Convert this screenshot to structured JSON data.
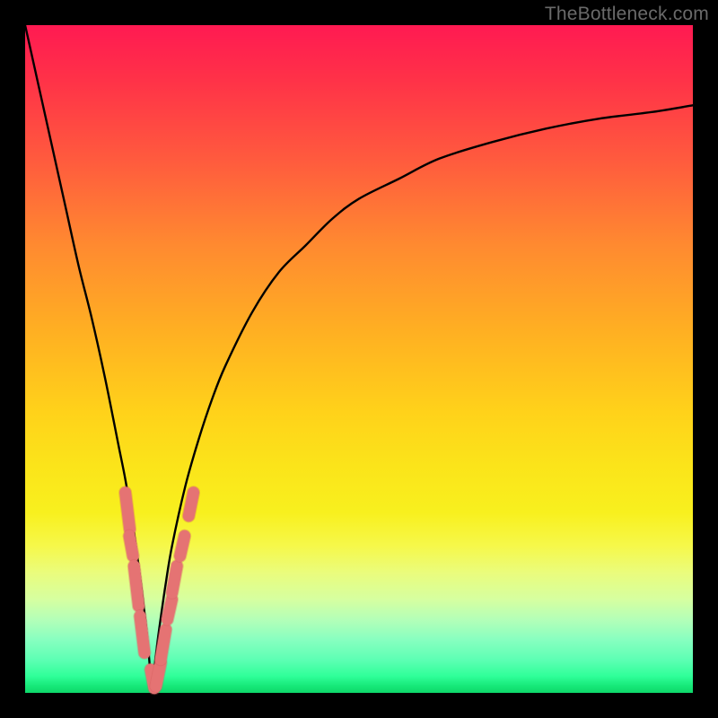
{
  "watermark": "TheBottleneck.com",
  "colors": {
    "frame": "#000000",
    "curve": "#000000",
    "markers_fill": "#e57373",
    "markers_stroke": "#d45f5f"
  },
  "chart_data": {
    "type": "line",
    "title": "",
    "xlabel": "",
    "ylabel": "",
    "xlim": [
      0,
      100
    ],
    "ylim": [
      0,
      100
    ],
    "note": "Unlabeled bottleneck V-curve; x axis ~ component ratio, y axis ~ bottleneck %. Minimum near x≈19, y≈0. Values estimated from pixels (plot has no tick labels).",
    "series": [
      {
        "name": "bottleneck-curve",
        "x": [
          0,
          2,
          4,
          6,
          8,
          10,
          12,
          14,
          15,
          16,
          17,
          18,
          18.5,
          19,
          19.5,
          20,
          21,
          22,
          24,
          26,
          28,
          30,
          34,
          38,
          42,
          46,
          50,
          56,
          62,
          70,
          78,
          86,
          94,
          100
        ],
        "y": [
          100,
          91,
          82,
          73,
          64,
          56,
          47,
          37,
          32,
          26,
          19,
          11,
          6,
          1,
          5,
          9,
          16,
          22,
          31,
          38,
          44,
          49,
          57,
          63,
          67,
          71,
          74,
          77,
          80,
          82.5,
          84.5,
          86,
          87,
          88
        ]
      }
    ],
    "markers": {
      "description": "Short pink pill-shaped markers clustered on both sides of the curve near its bottom",
      "segments": [
        {
          "side": "left",
          "x": 15.0,
          "y0": 30.0,
          "y1": 24.5
        },
        {
          "side": "left",
          "x": 15.6,
          "y0": 23.5,
          "y1": 20.5
        },
        {
          "side": "left",
          "x": 16.3,
          "y0": 19.0,
          "y1": 13.0
        },
        {
          "side": "left",
          "x": 17.2,
          "y0": 11.5,
          "y1": 6.0
        },
        {
          "side": "left",
          "x": 18.8,
          "y0": 3.5,
          "y1": 0.7
        },
        {
          "side": "right",
          "x": 19.6,
          "y0": 1.0,
          "y1": 4.5
        },
        {
          "side": "right",
          "x": 20.3,
          "y0": 5.0,
          "y1": 9.5
        },
        {
          "side": "right",
          "x": 21.3,
          "y0": 11.0,
          "y1": 14.0
        },
        {
          "side": "right",
          "x": 22.0,
          "y0": 15.0,
          "y1": 19.0
        },
        {
          "side": "right",
          "x": 23.2,
          "y0": 20.5,
          "y1": 23.5
        },
        {
          "side": "right",
          "x": 24.5,
          "y0": 26.5,
          "y1": 30.0
        }
      ]
    }
  }
}
